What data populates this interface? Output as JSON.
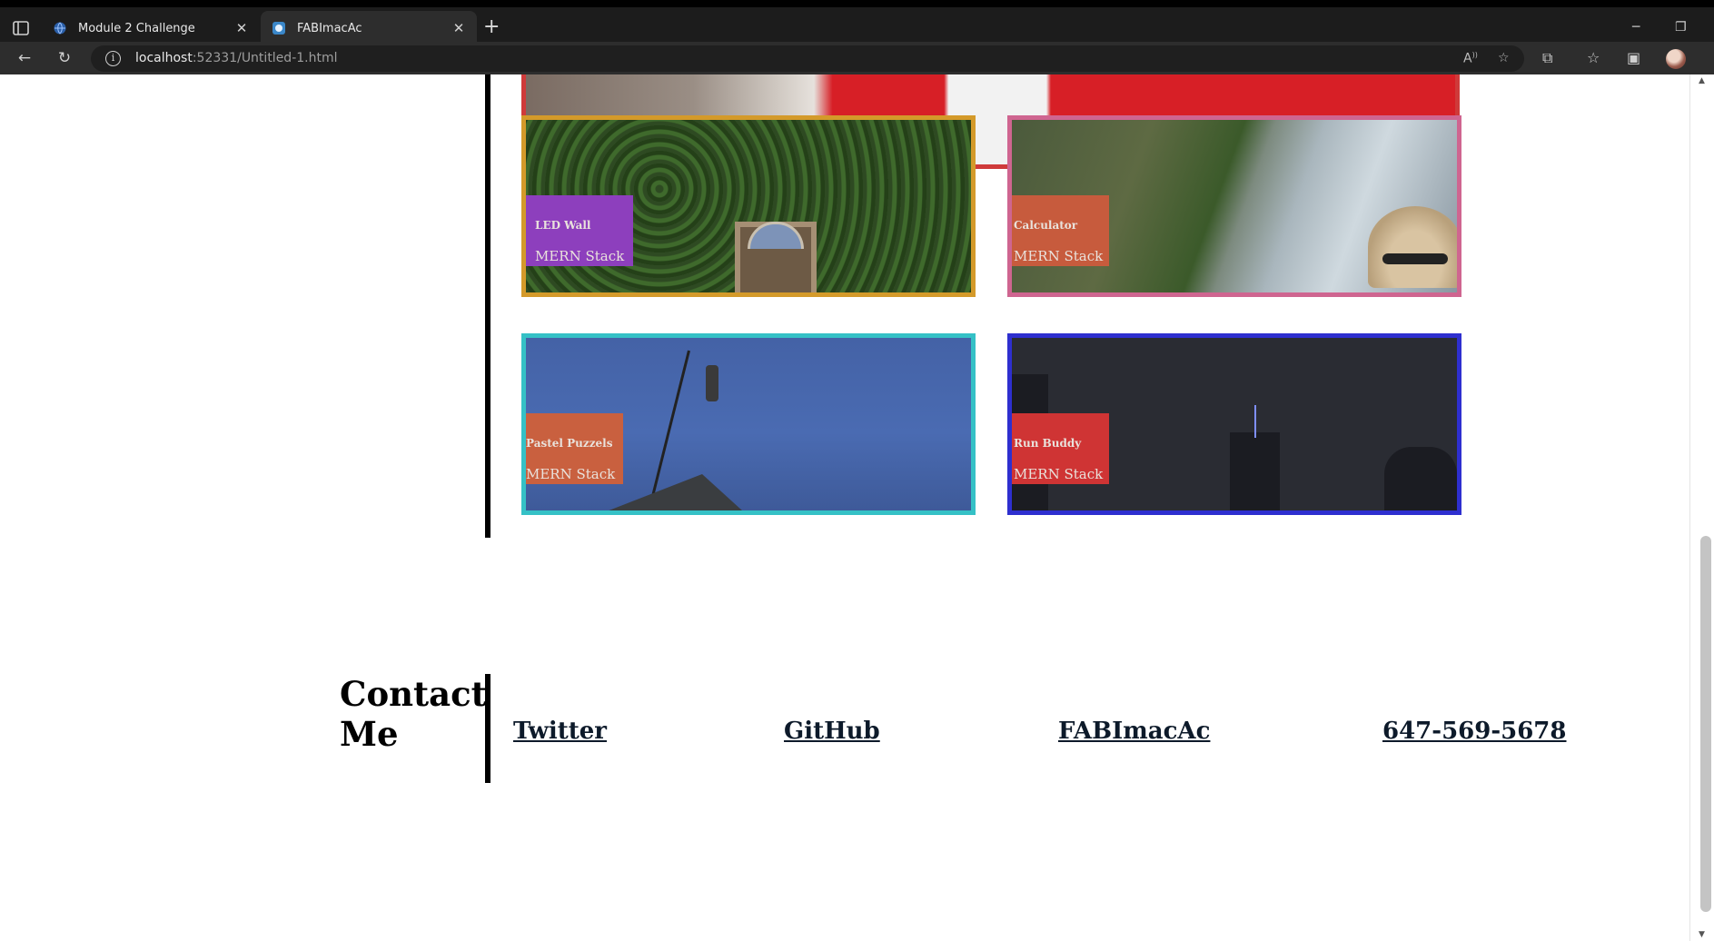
{
  "browser": {
    "tabs": [
      {
        "title": "Module 2 Challenge",
        "active": false
      },
      {
        "title": "FABImacAc",
        "active": true
      }
    ],
    "url_host": "localhost",
    "url_rest": ":52331/Untitled-1.html",
    "accent": "#2d2d2d"
  },
  "projects": [
    {
      "name": "LED Wall",
      "stack": "MERN Stack",
      "border": "#d49a2a",
      "label_bg": "#8d3fbd"
    },
    {
      "name": "Calculator",
      "stack": "MERN Stack",
      "border": "#cf6590",
      "label_bg": "#c75b3d"
    },
    {
      "name": "Pastel Puzzels",
      "stack": "MERN Stack",
      "border": "#35c1c6",
      "label_bg": "#c9603f"
    },
    {
      "name": "Run Buddy",
      "stack": "MERN Stack",
      "border": "#2e2fcf",
      "label_bg": "#cf3434"
    }
  ],
  "hero": {
    "border": "#cf3a3a"
  },
  "contact": {
    "heading": "Contact Me",
    "links": [
      "Twitter",
      "GitHub",
      "FABImacAc",
      "647-569-5678"
    ]
  }
}
